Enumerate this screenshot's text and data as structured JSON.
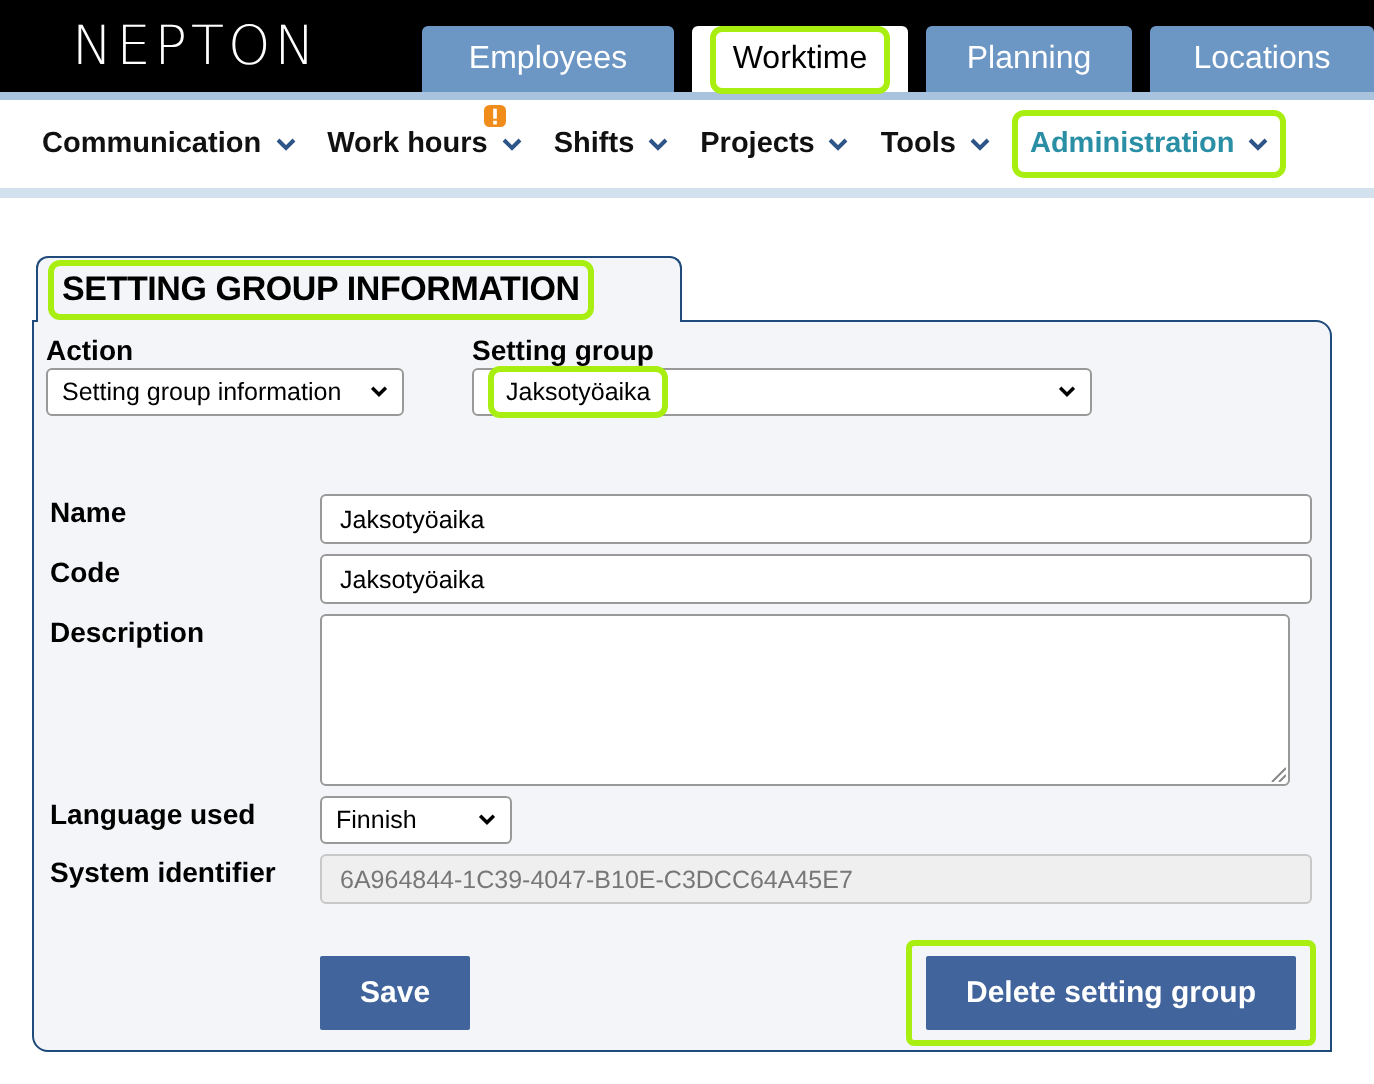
{
  "header": {
    "logo": "NEPTON",
    "tabs": [
      {
        "label": "Employees",
        "selected": false,
        "highlighted": false
      },
      {
        "label": "Worktime",
        "selected": true,
        "highlighted": true
      },
      {
        "label": "Planning",
        "selected": false,
        "highlighted": false
      },
      {
        "label": "Locations",
        "selected": false,
        "highlighted": false
      }
    ]
  },
  "menu": [
    {
      "label": "Communication",
      "selected": false,
      "highlighted": false,
      "alert": false
    },
    {
      "label": "Work hours",
      "selected": false,
      "highlighted": false,
      "alert": true
    },
    {
      "label": "Shifts",
      "selected": false,
      "highlighted": false,
      "alert": false
    },
    {
      "label": "Projects",
      "selected": false,
      "highlighted": false,
      "alert": false
    },
    {
      "label": "Tools",
      "selected": false,
      "highlighted": false,
      "alert": false
    },
    {
      "label": "Administration",
      "selected": true,
      "highlighted": true,
      "alert": false
    }
  ],
  "panel": {
    "title": "SETTING GROUP INFORMATION",
    "title_highlighted": true,
    "selectors": [
      {
        "label": "Action",
        "value": "Setting group information",
        "highlighted": false,
        "kind": "narrow"
      },
      {
        "label": "Setting group",
        "value": "Jaksotyöaika",
        "highlighted": true,
        "kind": "wide"
      }
    ],
    "fields": [
      {
        "label": "Name",
        "kind": "text",
        "value": "Jaksotyöaika",
        "disabled": false
      },
      {
        "label": "Code",
        "kind": "text",
        "value": "Jaksotyöaika",
        "disabled": false
      },
      {
        "label": "Description",
        "kind": "textarea"
      },
      {
        "label": "Language used",
        "kind": "select",
        "value": "Finnish"
      },
      {
        "label": "System identifier",
        "kind": "text",
        "value": "6A964844-1C39-4047-B10E-C3DCC64A45E7",
        "disabled": true
      }
    ],
    "buttons": [
      {
        "label": "Save",
        "highlighted": false
      },
      {
        "label": "Delete setting group",
        "highlighted": true
      }
    ]
  }
}
